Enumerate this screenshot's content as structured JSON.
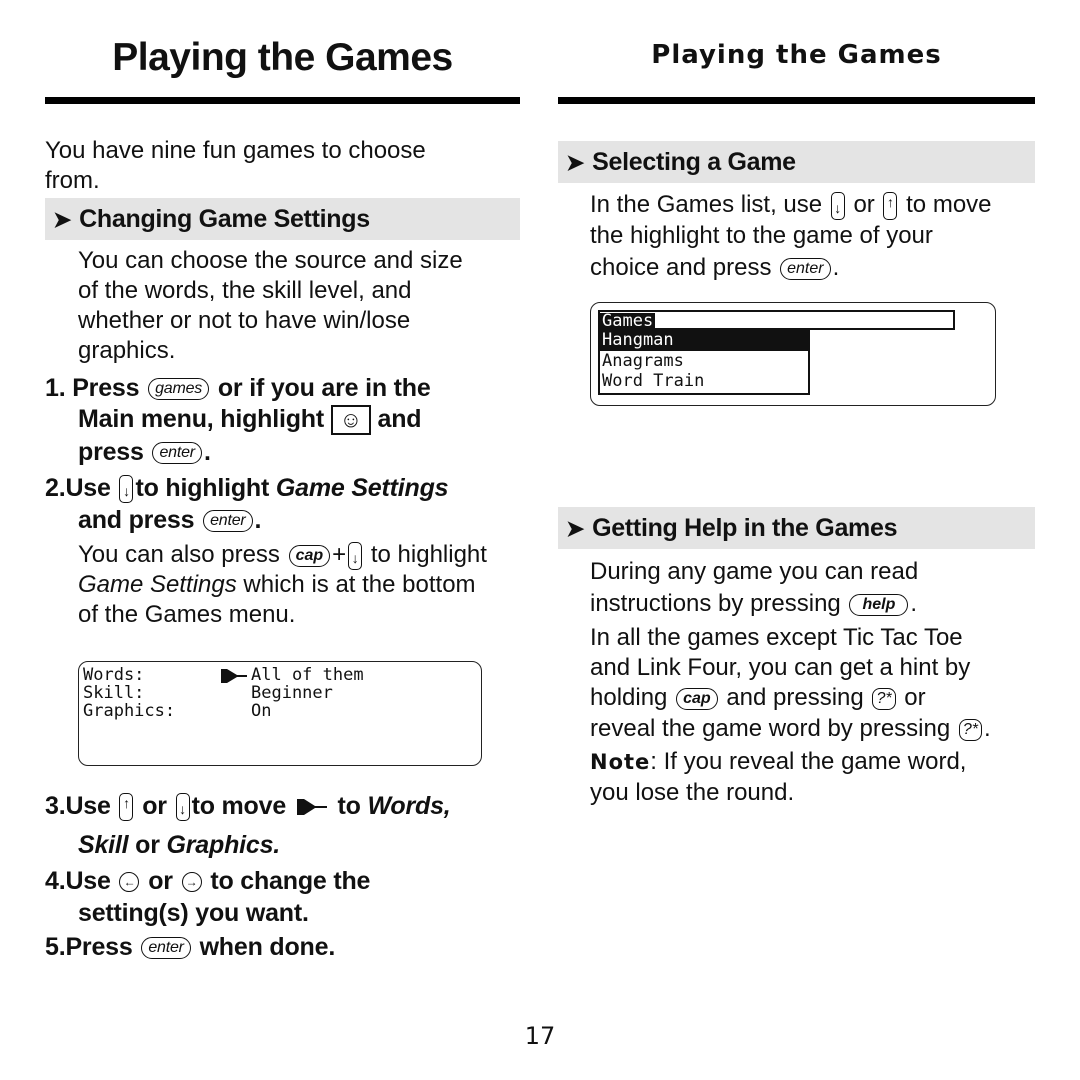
{
  "left": {
    "title": "Playing the Games",
    "intro": [
      "You have nine fun games to choose",
      "from."
    ],
    "section": "Changing Game Settings",
    "section_para": [
      "You can choose the source and size",
      "of the words, the skill level, and",
      "whether or not to have  win/lose",
      "graphics."
    ],
    "step1": {
      "num": "1.",
      "a": "Press",
      "key": "games",
      "b": "or if you are in the",
      "c": "Main menu, highlight",
      "d": "and",
      "e": "press",
      "key2": "enter",
      "end": "."
    },
    "step2": {
      "num": "2.",
      "a": "Use",
      "b": "to highlight",
      "italic": "Game Settings",
      "c": "and press",
      "key": "enter",
      "end": "."
    },
    "step2_note": {
      "a": "You can also press",
      "key": "cap",
      "plus": "+",
      "b": "to highlight",
      "italic": "Game Settings",
      "c": "which is at the bottom",
      "d": "of the Games menu."
    },
    "screen": {
      "rows": [
        {
          "label": "Words:",
          "value": "All of them",
          "selected": true
        },
        {
          "label": "Skill:",
          "value": "Beginner"
        },
        {
          "label": "Graphics:",
          "value": "On"
        }
      ]
    },
    "step3": {
      "num": "3.",
      "a": "Use",
      "or": "or",
      "b": "to move",
      "c": "to",
      "i1": "Words,",
      "i2": "Skill",
      "or2": "or",
      "i3": "Graphics."
    },
    "step4": {
      "num": "4.",
      "a": "Use",
      "or": "or",
      "b": "to change the",
      "c": "setting(s) you want."
    },
    "step5": {
      "num": "5.",
      "a": "Press",
      "key": "enter",
      "b": "when done."
    }
  },
  "right": {
    "title": "Playing the Games",
    "section1": "Selecting a Game",
    "s1": {
      "a": "In the Games list, use",
      "or": "or",
      "b": "to move",
      "c": "the highlight to the game of your",
      "d": "choice and press",
      "key": "enter",
      "end": "."
    },
    "screen": {
      "title": "Games",
      "items": [
        "Hangman",
        "Anagrams",
        "Word Train"
      ],
      "highlighted": "Hangman"
    },
    "section2": "Getting Help in the Games",
    "s2": {
      "a": "During any game you can read",
      "b": "instructions by pressing",
      "key": "help",
      "end": "."
    },
    "s3": {
      "a": "In all the games except Tic Tac Toe",
      "b": "and Link Four, you can get a hint by",
      "c": "holding",
      "key_cap": "cap",
      "d": "and pressing",
      "key_q": "?*",
      "e": "or",
      "f": "reveal the game word by pressing",
      "end": "."
    },
    "note": {
      "label": "Note",
      "a": ": If you reveal the game word,",
      "b": "you lose the round."
    }
  },
  "page_number": "17"
}
